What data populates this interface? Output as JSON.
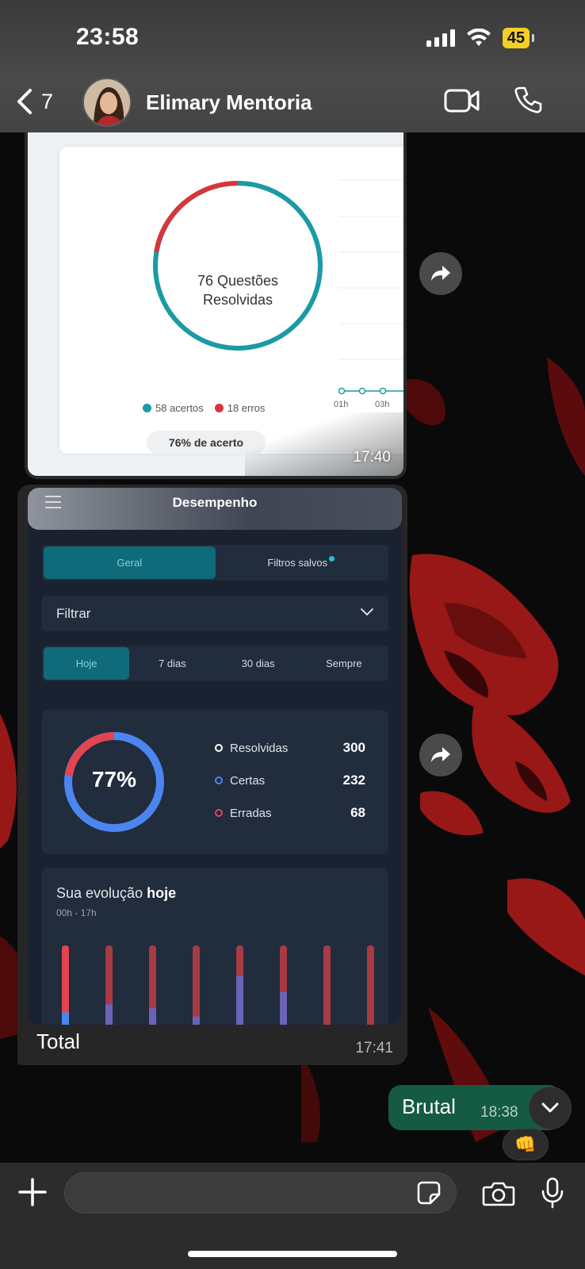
{
  "status_bar": {
    "time": "23:58",
    "battery": "45"
  },
  "header": {
    "back_count": "7",
    "contact_name": "Elimary Mentoria"
  },
  "messages": {
    "image1": {
      "donut_label_line1": "76 Questões",
      "donut_label_line2": "Resolvidas",
      "legend_correct": "58 acertos",
      "legend_wrong": "18 erros",
      "accuracy_pill": "76% de acerto",
      "axis_tick_1": "01h",
      "axis_tick_2": "03h",
      "time": "17:40",
      "colors": {
        "correct": "#1a9aa4",
        "wrong": "#d8353a"
      }
    },
    "image2": {
      "title": "Desempenho",
      "tabs": [
        {
          "label": "Geral",
          "active": true
        },
        {
          "label": "Filtros salvos",
          "active": false
        }
      ],
      "filter_label": "Filtrar",
      "periods": [
        {
          "label": "Hoje",
          "active": true
        },
        {
          "label": "7 dias"
        },
        {
          "label": "30 dias"
        },
        {
          "label": "Sempre"
        }
      ],
      "percentage": "77%",
      "stats": [
        {
          "label": "Resolvidas",
          "value": "300",
          "color": "#ffffff"
        },
        {
          "label": "Certas",
          "value": "232",
          "color": "#4b86f0"
        },
        {
          "label": "Erradas",
          "value": "68",
          "color": "#e2454f"
        }
      ],
      "evolution_title": "Sua evolução",
      "evolution_title_bold": "hoje",
      "evolution_range": "00h - 17h",
      "evolution_bars_right_fraction": [
        0.25,
        0.35,
        0.3,
        0.2,
        0.7,
        0.5,
        0.0,
        0.0
      ],
      "colors": {
        "right": "#4b86f0",
        "wrong": "#e2454f",
        "accent": "#0f6a79"
      }
    },
    "caption": "Total",
    "caption_time": "17:41",
    "outgoing": {
      "text": "Brutal",
      "time": "18:38",
      "reaction": "👊"
    }
  },
  "composer": {
    "placeholder": ""
  }
}
